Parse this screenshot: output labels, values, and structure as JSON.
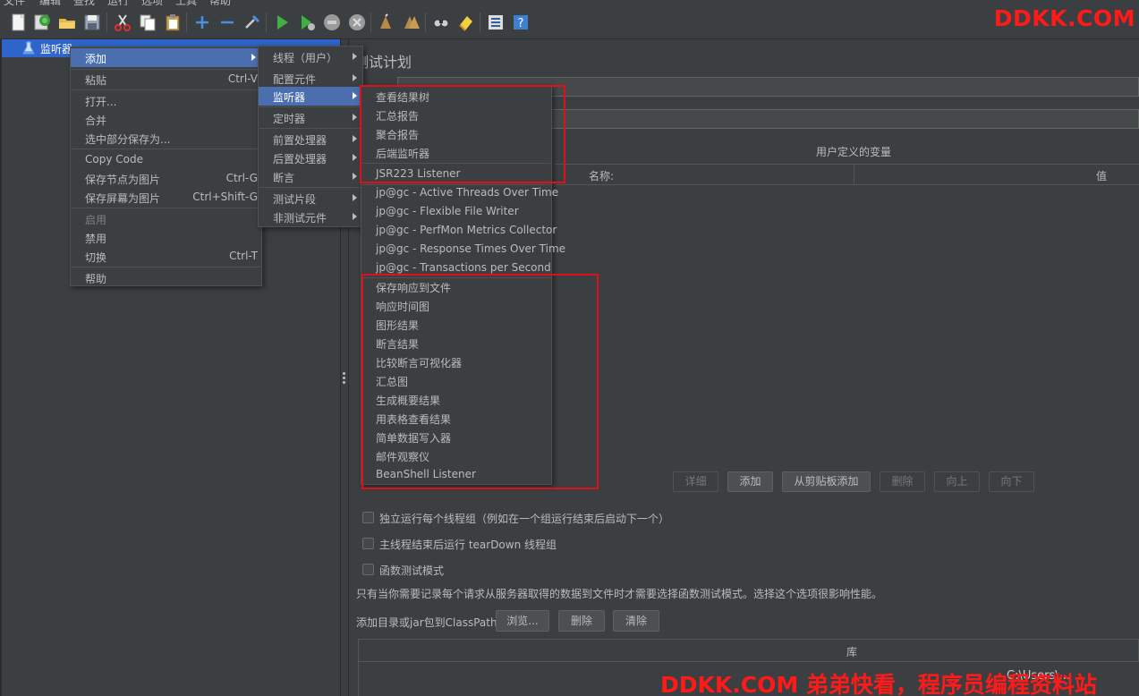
{
  "menubar": {
    "items": [
      "文件",
      "编辑",
      "查找",
      "运行",
      "选项",
      "工具",
      "帮助"
    ]
  },
  "toolbar": {
    "icons": [
      "new-icon",
      "templates-icon",
      "open-icon",
      "save-icon",
      "cut-icon",
      "copy-icon",
      "paste-icon",
      "expand-icon",
      "collapse-icon",
      "toggle-icon",
      "start-icon",
      "start-no-pause-icon",
      "stop-icon",
      "shutdown-icon",
      "clear-icon",
      "clear-all-icon",
      "search-icon",
      "reset-search-icon",
      "function-helper-icon",
      "help-icon"
    ]
  },
  "watermark": {
    "top": "DDKK.COM",
    "bottom": "DDKK.COM 弟弟快看，程序员编程资料站"
  },
  "tree": {
    "selected_label": "监听器"
  },
  "context_menu": {
    "add": "添加",
    "paste": "粘贴",
    "paste_shortcut": "Ctrl-V",
    "open": "打开...",
    "merge": "合并",
    "save_selection": "选中部分保存为...",
    "copy_code": "Copy Code",
    "save_node_image": "保存节点为图片",
    "save_node_image_shortcut": "Ctrl-G",
    "save_screen_image": "保存屏幕为图片",
    "save_screen_image_shortcut": "Ctrl+Shift-G",
    "enable": "启用",
    "disable": "禁用",
    "toggle": "切换",
    "toggle_shortcut": "Ctrl-T",
    "help": "帮助"
  },
  "add_submenu": {
    "items": [
      "线程（用户）",
      "配置元件",
      "监听器",
      "定时器",
      "前置处理器",
      "后置处理器",
      "断言",
      "测试片段",
      "非测试元件"
    ]
  },
  "listener_submenu": {
    "items": [
      "查看结果树",
      "汇总报告",
      "聚合报告",
      "后端监听器",
      "JSR223 Listener",
      "jp@gc - Active Threads Over Time",
      "jp@gc - Flexible File Writer",
      "jp@gc - PerfMon Metrics Collector",
      "jp@gc - Response Times Over Time",
      "jp@gc - Transactions per Second",
      "保存响应到文件",
      "响应时间图",
      "图形结果",
      "断言结果",
      "比较断言可视化器",
      "汇总图",
      "生成概要结果",
      "用表格查看结果",
      "简单数据写入器",
      "邮件观察仪",
      "BeanShell Listener"
    ]
  },
  "test_plan": {
    "title": "测试计划",
    "name_value": "监听器",
    "user_vars_title": "用户定义的变量",
    "col_name": "名称:",
    "col_value": "值",
    "buttons": {
      "detail": "详细",
      "add": "添加",
      "add_clipboard": "从剪贴板添加",
      "delete": "删除",
      "up": "向上",
      "down": "向下"
    },
    "checkboxes": [
      "独立运行每个线程组（例如在一个组运行结束后启动下一个）",
      "主线程结束后运行 tearDown 线程组",
      "函数测试模式"
    ],
    "note": "只有当你需要记录每个请求从服务器取得的数据到文件时才需要选择函数测试模式。选择这个选项很影响性能。",
    "classpath_label": "添加目录或jar包到ClassPath",
    "cp_buttons": {
      "browse": "浏览...",
      "delete": "删除",
      "clear": "清除"
    },
    "lib_title": "库",
    "lib_entry": "C:\\Users\\..."
  },
  "colors": {
    "selection": "#4b6eaf",
    "tree_selection": "#2f65ca",
    "highlight_box": "#e0101a",
    "background": "#3c3f41"
  }
}
